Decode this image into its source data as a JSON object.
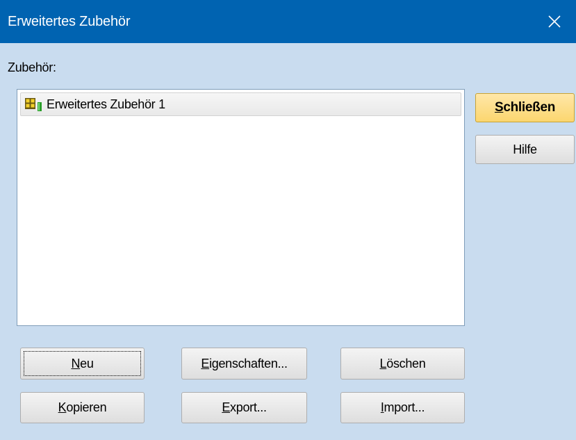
{
  "window": {
    "title": "Erweitertes Zubehör",
    "close_icon": "close-icon"
  },
  "list": {
    "label": "Zubehör:",
    "items": [
      {
        "label": "Erweitertes Zubehör 1",
        "icon": "accessory-icon",
        "selected": true
      }
    ]
  },
  "side_buttons": {
    "close": {
      "mnemonic": "S",
      "rest": "chließen"
    },
    "help": {
      "label": "Hilfe"
    }
  },
  "bottom_buttons": {
    "new": {
      "mnemonic": "N",
      "rest": "eu"
    },
    "properties": {
      "mnemonic": "E",
      "rest": "igenschaften..."
    },
    "delete": {
      "mnemonic": "L",
      "rest": "öschen"
    },
    "copy": {
      "mnemonic": "K",
      "rest": "opieren"
    },
    "export": {
      "mnemonic": "E",
      "rest": "xport..."
    },
    "import": {
      "mnemonic": "I",
      "rest": "mport..."
    }
  },
  "colors": {
    "titlebar": "#0063b1",
    "dialog_background": "#c9dcef",
    "default_button": "#fbd66f"
  }
}
